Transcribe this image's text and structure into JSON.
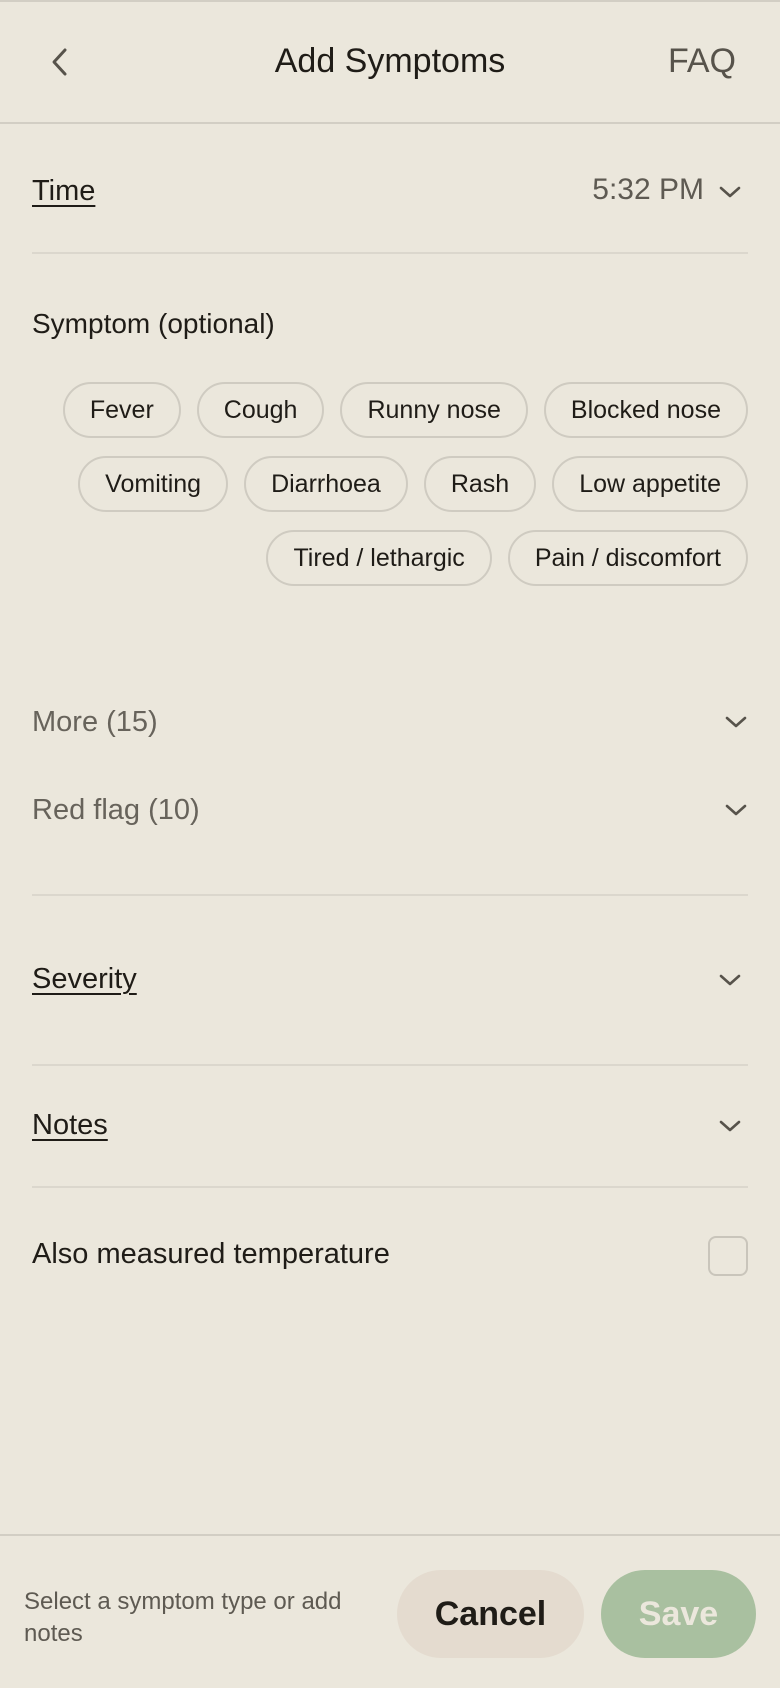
{
  "header": {
    "title": "Add Symptoms",
    "faq_label": "FAQ",
    "back_icon": "chevron-left-icon"
  },
  "time": {
    "label": "Time",
    "value": "5:32 PM"
  },
  "symptom": {
    "heading": "Symptom (optional)",
    "chips": [
      "Fever",
      "Cough",
      "Runny nose",
      "Blocked nose",
      "Vomiting",
      "Diarrhoea",
      "Rash",
      "Low appetite",
      "Tired / lethargic",
      "Pain / discomfort"
    ],
    "more_label": "More (15)",
    "red_flag_label": "Red flag (10)"
  },
  "severity": {
    "label": "Severity"
  },
  "notes": {
    "label": "Notes"
  },
  "temperature": {
    "label": "Also measured temperature",
    "checked": false
  },
  "footer": {
    "hint": "Select a symptom type or add notes",
    "cancel_label": "Cancel",
    "save_label": "Save"
  },
  "colors": {
    "background": "#ebe7dc",
    "cancel_bg": "#e4dbcf",
    "save_bg": "#a9c0a0",
    "text_primary": "#1f1c17",
    "text_muted": "#67635b"
  }
}
